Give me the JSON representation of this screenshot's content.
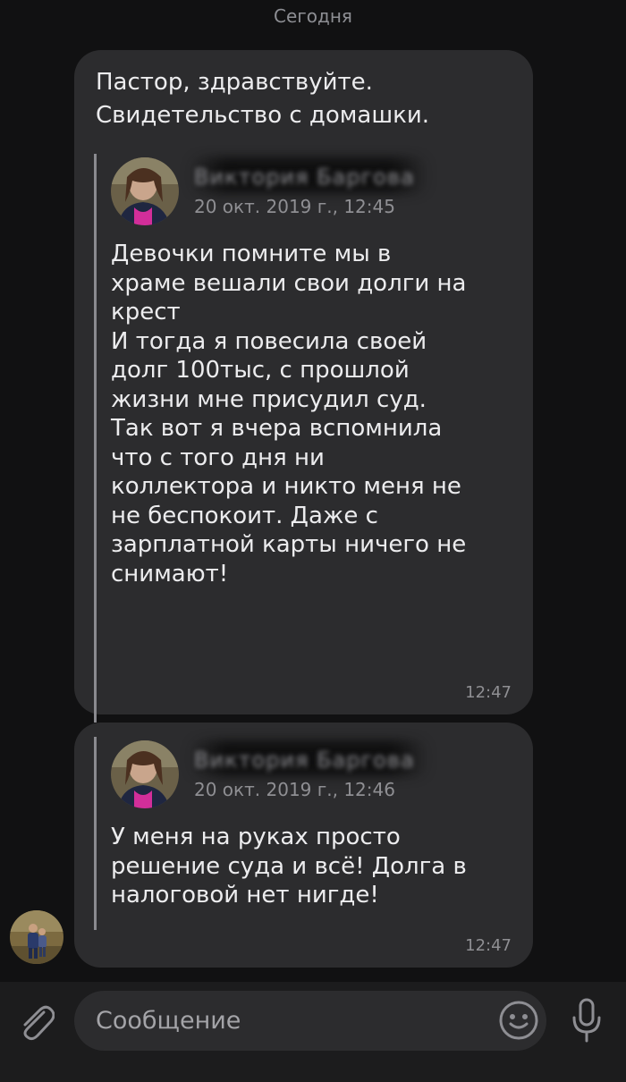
{
  "date_separator": "Сегодня",
  "messages": [
    {
      "text": "Пастор, здравствуйте.\nСвидетельство с домашки.",
      "quote": {
        "author": "Виктория Баргова",
        "date": "20 окт. 2019 г., 12:45",
        "text": "Девочки помните мы в\nхраме вешали свои долги на\nкрест\nИ тогда я повесила своей\nдолг 100тыс, с прошлой\nжизни мне присудил суд.\nТак вот я вчера вспомнила\nчто с того дня ни\nколлектора и никто меня не\nне беспокоит. Даже с\nзарплатной карты ничего не\nснимают!"
      },
      "time": "12:47"
    },
    {
      "quote": {
        "author": "Виктория Баргова",
        "date": "20 окт. 2019 г., 12:46",
        "text": "У меня на руках просто\nрешение суда и всё! Долга в\nналоговой нет нигде!"
      },
      "time": "12:47"
    }
  ],
  "composer": {
    "placeholder": "Сообщение"
  },
  "icons": {
    "attach": "paperclip-icon",
    "emoji": "smiley-icon",
    "mic": "microphone-icon"
  },
  "colors": {
    "background": "#111112",
    "bubble": "#2c2c2e",
    "quote_bar": "#8a8a8f",
    "muted_text": "#8f8f93"
  }
}
